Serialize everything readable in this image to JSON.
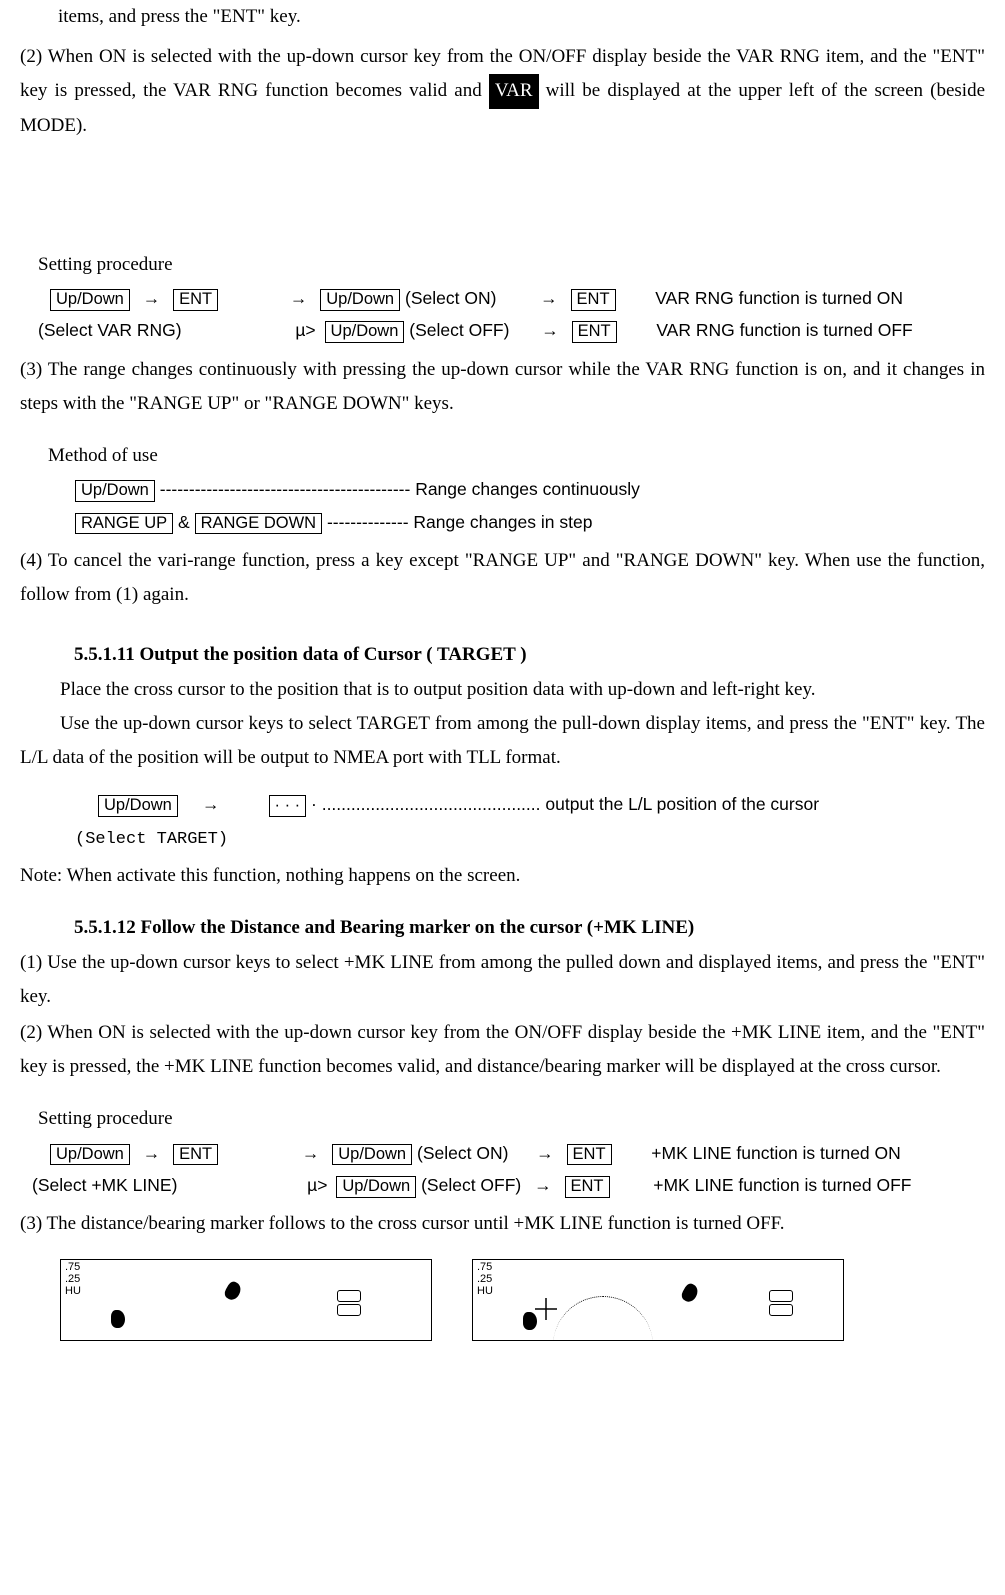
{
  "keys": {
    "updown": "Up/Down",
    "ent": "ENT",
    "rangeup": "RANGE UP",
    "rangedown": "RANGE DOWN",
    "dots": "· · ·"
  },
  "labels": {
    "var_badge": "VAR",
    "select_on": "(Select ON)",
    "select_off": "(Select OFF)",
    "select_var_rng": "(Select VAR RNG)",
    "select_target": "(Select TARGET)",
    "select_mk_line": "(Select +MK LINE)",
    "setting_proc": "Setting procedure",
    "method_of_use": "Method of use"
  },
  "text": {
    "p0": "items, and press the \"ENT\" key.",
    "p2a": "(2)  When ON is selected with the up-down cursor key from the ON/OFF display beside the VAR RNG item, and the \"ENT\" key is pressed, the VAR RNG function becomes valid and ",
    "p2b": "  will be displayed at the upper left of the screen (beside MODE).",
    "var_on_result": "VAR RNG function is turned ON",
    "var_off_result": "VAR RNG function is turned OFF",
    "p3": "(3)   The  range  changes  continuously  with  pressing  the  up-down  cursor  while  the  VAR  RNG function is on, and it changes in steps with the \"RANGE UP\" or \"RANGE DOWN\" keys.",
    "method_line1": " ------------------------------------------- Range changes continuously",
    "method_amp": " & ",
    "method_line2": " -------------- Range changes in step",
    "p4": "(4)   To cancel the vari-range function, press a key except \"RANGE UP\" and \"RANGE DOWN\" key. When use the function, follow from (1) again.",
    "h11_num": "5.5.1.11",
    "h11_title": " Output the position data of Cursor ( TARGET )",
    "h11_p1": "Place the cross cursor to the position that is to output position data with up-down and left-right key.",
    "h11_p2": "Use the up-down cursor keys to select TARGET from among the pull-down display items, and press the \"ENT\" key. The L/L data of the position will be output to NMEA port with TLL format.",
    "target_dots_line": " · ............................................. output the L/L position of the cursor",
    "note": "Note: When activate this function, nothing happens on the screen.",
    "h12_num": "5.5.1.12",
    "h12_title": " Follow the Distance and Bearing marker on the cursor (+MK LINE)",
    "h12_p1": "(1)  Use the up-down cursor keys to select +MK LINE from among the pulled down and displayed items, and press the \"ENT\" key.",
    "h12_p2": "(2)  When ON is selected with the up-down cursor key from the ON/OFF display beside the +MK LINE  item,  and  the  \"ENT\"  key  is  pressed,  the  +MK  LINE  function  becomes  valid,  and distance/bearing marker will be displayed at the cross cursor.",
    "mk_on_result": "+MK LINE function is turned ON",
    "mk_off_result": "+MK LINE function is turned OFF",
    "h12_p3": "(3)  The distance/bearing marker follows to the cross cursor until +MK LINE function is turned OFF.",
    "fig_corner1": ".75",
    "fig_corner2": ".25",
    "fig_corner3": "HU"
  }
}
